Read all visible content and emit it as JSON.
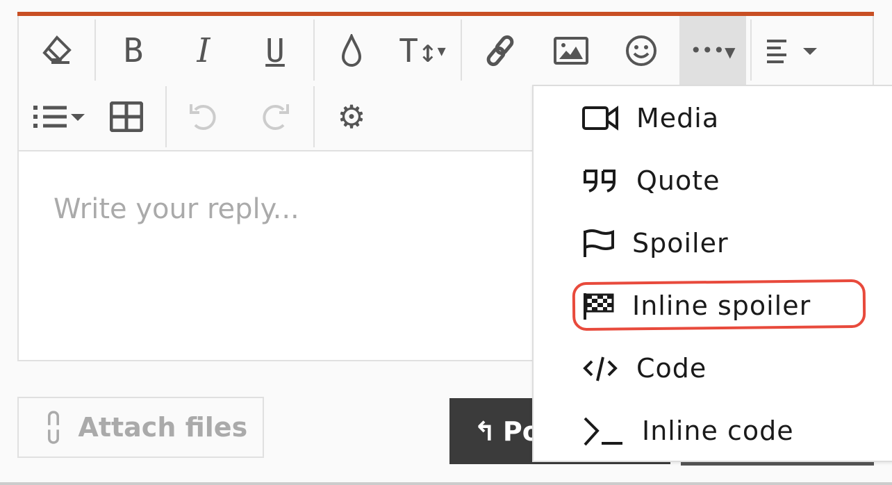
{
  "editor": {
    "accent_color": "#c84f24",
    "toolbar_row1": [
      "eraser-icon",
      "bold-icon",
      "italic-icon",
      "underline-icon",
      "droplet-icon",
      "text-size-icon",
      "link-icon",
      "image-icon",
      "smiley-icon",
      "more-options-icon",
      "align-icon"
    ],
    "toolbar_row2": [
      "list-icon",
      "table-icon",
      "undo-icon",
      "redo-icon",
      "gear-icon"
    ],
    "placeholder": "Write your reply..."
  },
  "actions": {
    "attach_label": "Attach files",
    "post_label": "Post reply"
  },
  "menu": {
    "items": [
      {
        "label": "Media",
        "icon": "video-camera-icon"
      },
      {
        "label": "Quote",
        "icon": "quote-icon"
      },
      {
        "label": "Spoiler",
        "icon": "flag-icon"
      },
      {
        "label": "Inline spoiler",
        "icon": "checkered-flag-icon",
        "highlighted": true
      },
      {
        "label": "Code",
        "icon": "code-icon"
      },
      {
        "label": "Inline code",
        "icon": "terminal-icon"
      }
    ]
  },
  "annotation_color": "#e84a3c"
}
